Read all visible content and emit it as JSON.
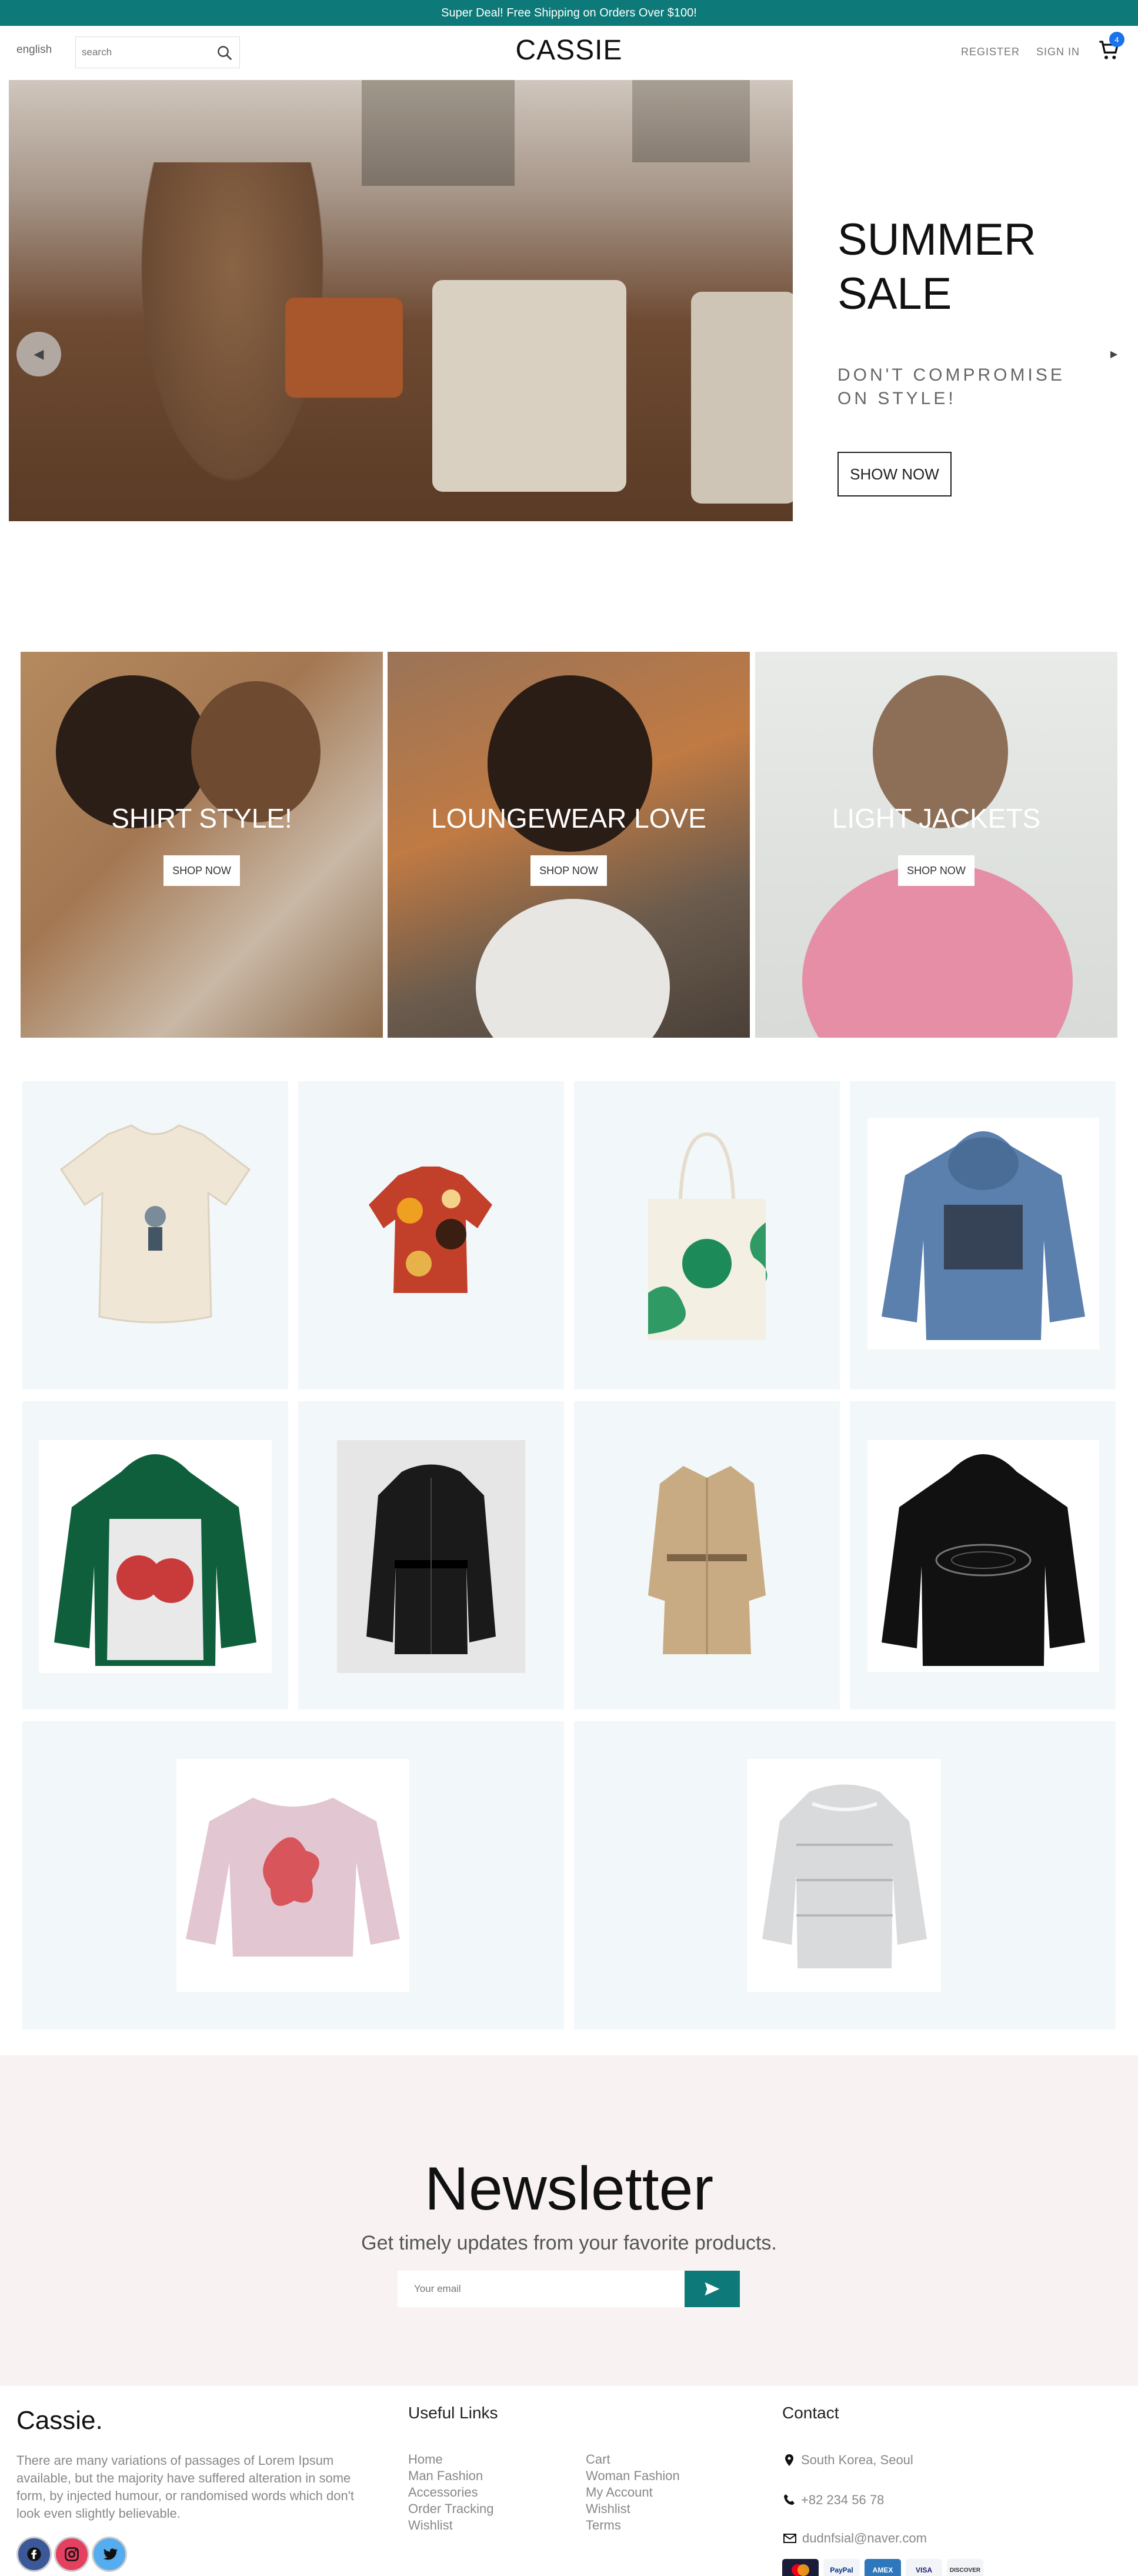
{
  "topbar": {
    "text": "Super Deal! Free Shipping on Orders Over $100!"
  },
  "header": {
    "language": "english",
    "search_placeholder": "search",
    "logo": "CASSIE",
    "register": "REGISTER",
    "sign_in": "SIGN IN",
    "cart_count": "4"
  },
  "hero": {
    "title_line1": "SUMMER",
    "title_line2": "SALE",
    "subtitle": "DON'T COMPROMISE ON STYLE!",
    "button": "SHOW NOW"
  },
  "categories": [
    {
      "title": "SHIRT STYLE!",
      "button": "SHOP NOW"
    },
    {
      "title": "LOUNGEWEAR LOVE",
      "button": "SHOP NOW"
    },
    {
      "title": "LIGHT JACKETS",
      "button": "SHOP NOW"
    }
  ],
  "products": [
    {
      "icon": "cream-tshirt"
    },
    {
      "icon": "patterned-shirt"
    },
    {
      "icon": "tote-bag"
    },
    {
      "icon": "blue-hoodie"
    },
    {
      "icon": "green-cherry-hoodie"
    },
    {
      "icon": "black-puffer-jacket"
    },
    {
      "icon": "beige-trench-coat"
    },
    {
      "icon": "black-hoodie"
    },
    {
      "icon": "pink-sweater"
    },
    {
      "icon": "silver-puffer-jacket"
    }
  ],
  "newsletter": {
    "title": "Newsletter",
    "subtitle": "Get timely updates from your favorite products.",
    "email_placeholder": "Your email"
  },
  "footer": {
    "logo": "Cassie.",
    "description": "There are many variations of passages of Lorem Ipsum available, but the majority have suffered alteration in some form, by injected humour, or randomised words which don't look even slightly believable.",
    "useful_links_title": "Useful Links",
    "links_col1": [
      "Home",
      "Man Fashion",
      "Accessories",
      "Order Tracking",
      "Wishlist"
    ],
    "links_col2": [
      "Cart",
      "Woman Fashion",
      "My Account",
      "Wishlist",
      "Terms"
    ],
    "contact_title": "Contact",
    "address": "South Korea, Seoul",
    "phone": "+82 234 56 78",
    "email": "dudnfsial@naver.com",
    "payments": [
      "MasterCard",
      "PayPal",
      "AMEX",
      "VISA",
      "DISCOVER"
    ]
  },
  "colors": {
    "accent": "#0d7a79",
    "badge": "#1a73e8",
    "newsletter_bg": "#f8f3f2",
    "product_bg": "#f2f7fa"
  }
}
